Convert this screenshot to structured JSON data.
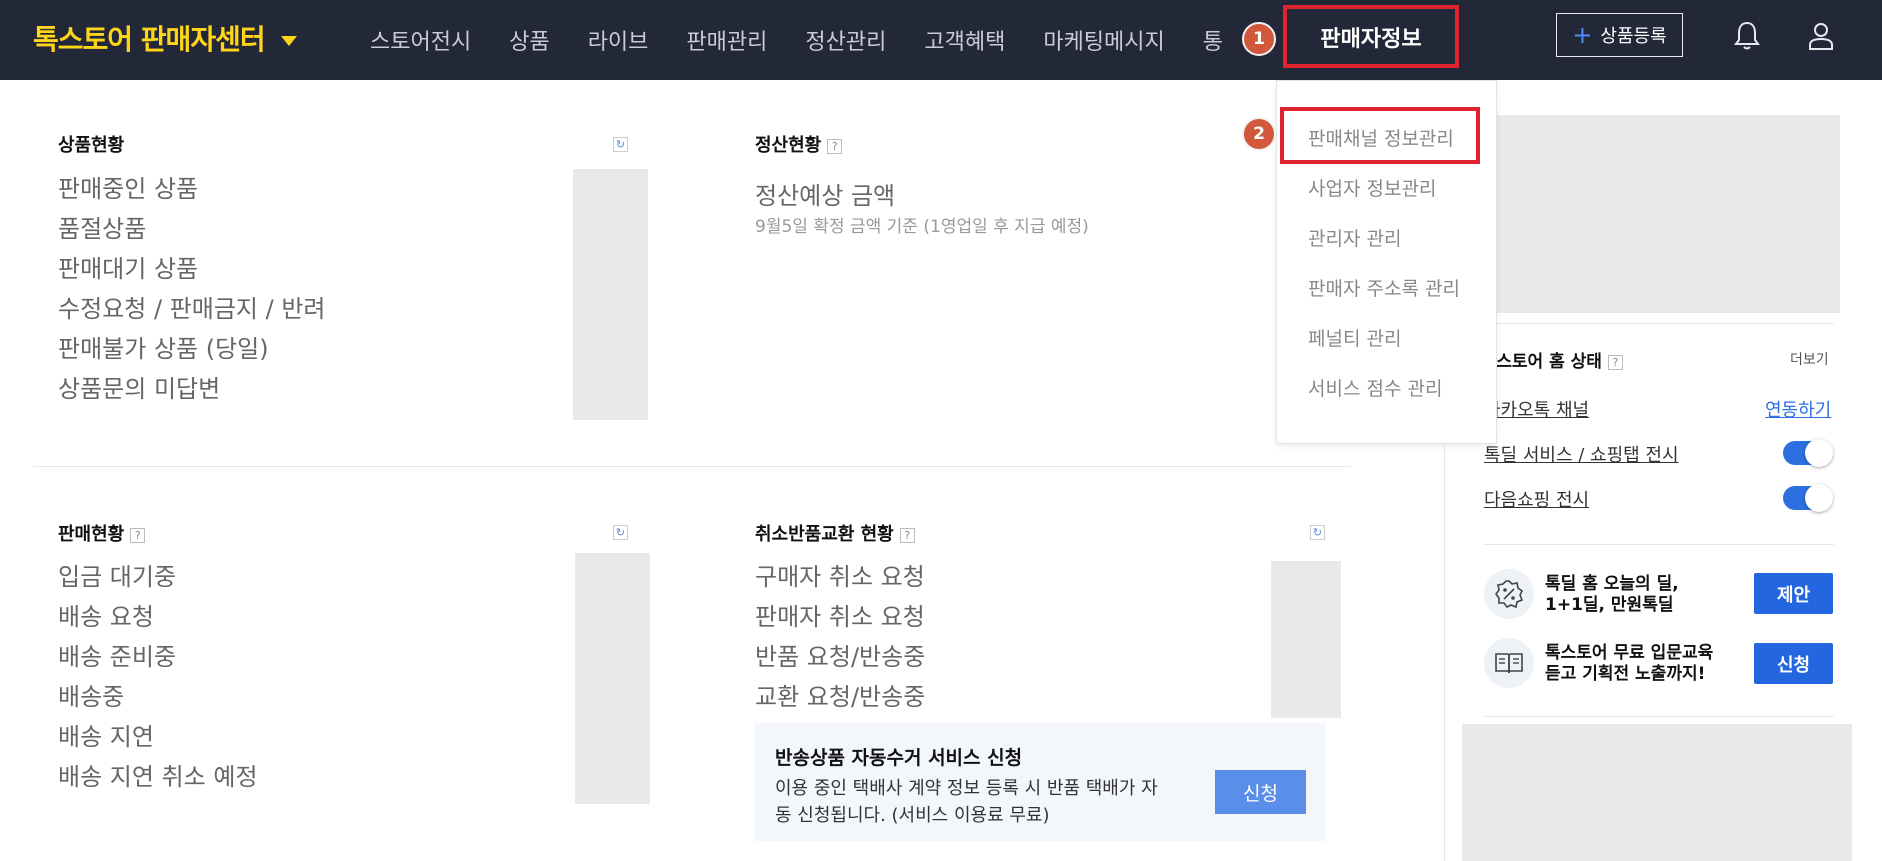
{
  "header": {
    "brand_main": "톡스토어",
    "brand_sub": "판매자센터",
    "nav": [
      "스토어전시",
      "상품",
      "라이브",
      "판매관리",
      "정산관리",
      "고객혜택",
      "마케팅메시지",
      "통"
    ],
    "active_nav": "판매자정보",
    "register_label": "상품등록"
  },
  "annotations": {
    "step1": "1",
    "step2": "2",
    "highlight_color": "#e0232e",
    "badge_color": "#d2583c"
  },
  "dropdown": {
    "items": [
      "판매채널 정보관리",
      "사업자 정보관리",
      "관리자 관리",
      "판매자 주소록 관리",
      "페널티 관리",
      "서비스 점수 관리"
    ]
  },
  "product_status": {
    "title": "상품현황",
    "items": [
      "판매중인 상품",
      "품절상품",
      "판매대기 상품",
      "수정요청 / 판매금지 / 반려",
      "판매불가 상품 (당일)",
      "상품문의 미답변"
    ]
  },
  "settlement": {
    "title": "정산현황",
    "label": "정산예상 금액",
    "sub": "9월5일 확정 금액 기준 (1영업일 후 지급 예정)"
  },
  "sales_status": {
    "title": "판매현황",
    "items": [
      "입금 대기중",
      "배송 요청",
      "배송 준비중",
      "배송중",
      "배송 지연",
      "배송 지연 취소 예정"
    ]
  },
  "cancel_return": {
    "title": "취소반품교환 현황",
    "items": [
      "구매자 취소 요청",
      "판매자 취소 요청",
      "반품 요청/반송중",
      "교환 요청/반송중"
    ]
  },
  "return_promo": {
    "title": "반송상품 자동수거 서비스 신청",
    "desc": "이용 중인 택배사 계약 정보 등록 시 반품 택배가 자동 신청됩니다. (서비스 이용료 무료)",
    "button": "신청"
  },
  "store_home": {
    "title": "I 스토어 홈 상태",
    "more": "더보기",
    "kakao_channel": "카카오톡 채널",
    "kakao_link": "연동하기",
    "todeal": "톡딜 서비스 / 쇼핑탭 전시",
    "daum": "다음쇼핑 전시",
    "todeal_on": true,
    "daum_on": true
  },
  "promos": [
    {
      "line1": "톡딜 홈 오늘의 딜,",
      "line2": "1+1딜, 만원톡딜",
      "button": "제안",
      "icon": "percent-badge-icon"
    },
    {
      "line1": "톡스토어 무료 입문교육",
      "line2": "듣고 기획전 노출까지!",
      "button": "신청",
      "icon": "book-icon"
    }
  ],
  "colors": {
    "header_bg": "#232838",
    "brand": "#ffd51a",
    "primary_blue": "#2466e0"
  }
}
